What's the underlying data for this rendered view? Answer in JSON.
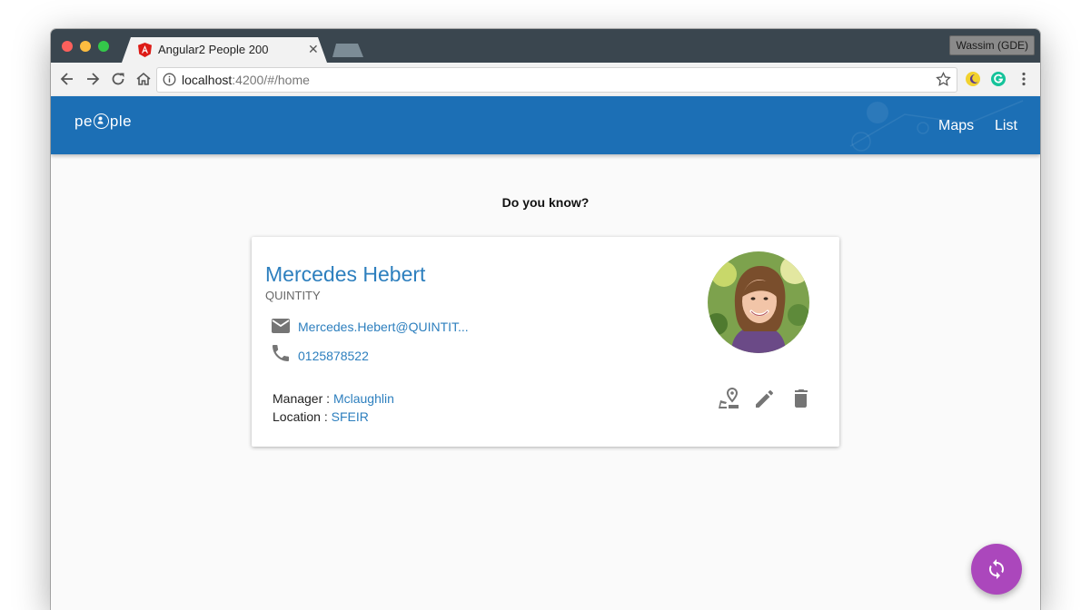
{
  "browser": {
    "tab_title": "Angular2 People 200",
    "profile_label": "Wassim (GDE)",
    "url_host": "localhost",
    "url_rest": ":4200/#/home"
  },
  "appbar": {
    "logo_left": "pe",
    "logo_right": "ple",
    "nav": [
      {
        "label": "Maps"
      },
      {
        "label": "List"
      }
    ]
  },
  "page": {
    "heading": "Do you know?"
  },
  "person": {
    "name": "Mercedes Hebert",
    "company": "QUINTITY",
    "email": "Mercedes.Hebert@QUINTIT...",
    "phone": "0125878522",
    "manager_label": "Manager : ",
    "manager": "Mclaughlin",
    "location_label": "Location : ",
    "location": "SFEIR"
  },
  "colors": {
    "appbar": "#1c6fb5",
    "link": "#2d7fbe",
    "fab": "#ab47bc"
  },
  "icons": [
    "angular-icon",
    "back-icon",
    "forward-icon",
    "reload-icon",
    "home-icon",
    "info-icon",
    "star-icon",
    "extension-icon",
    "grammarly-icon",
    "menu-icon",
    "email-icon",
    "phone-icon",
    "map-marker-icon",
    "edit-icon",
    "delete-icon",
    "refresh-icon"
  ]
}
